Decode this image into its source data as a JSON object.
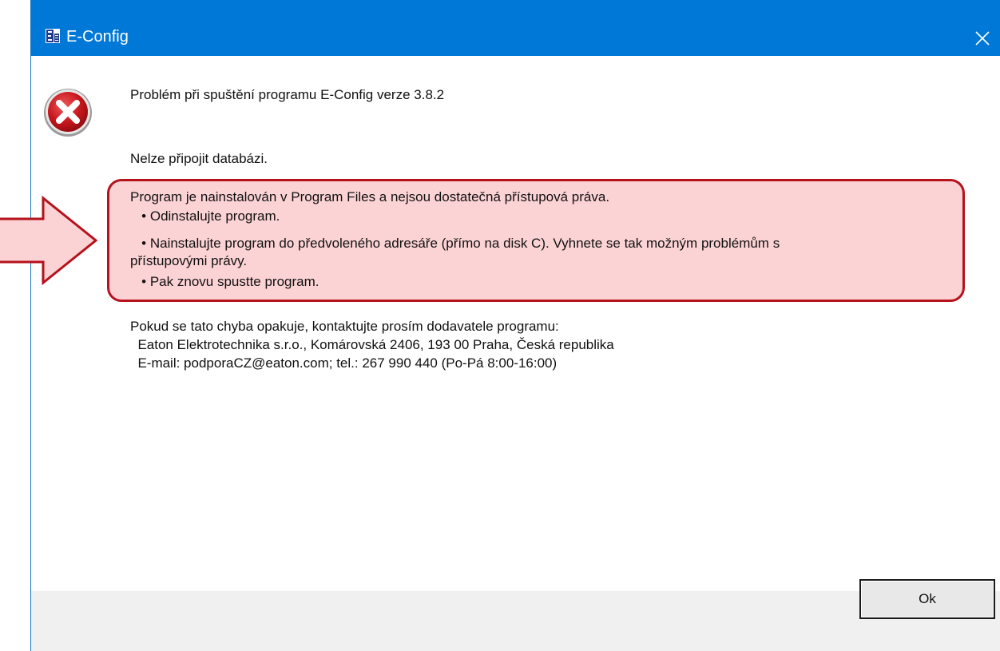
{
  "window": {
    "title": "E-Config",
    "icons": {
      "app": "e-config-app-icon",
      "close": "close-icon",
      "error": "error-x-icon"
    }
  },
  "message": {
    "heading": "Problém při spuštění programu E-Config verze 3.8.2",
    "db_error": "Nelze připojit databázi.",
    "highlight_lines": [
      "Program je nainstalován v Program Files a nejsou dostatečná přístupová práva.",
      "   • Odinstalujte program.",
      "   • Nainstalujte program do předvoleného adresáře (přímo na disk C). Vyhnete se tak možným problémům s",
      "přístupovými právy.",
      "   • Pak znovu spustte program."
    ],
    "contact_lines": [
      "Pokud se tato chyba opakuje, kontaktujte prosím dodavatele programu:",
      "  Eaton Elektrotechnika s.r.o., Komárovská 2406, 193 00 Praha, Česká republika",
      "  E-mail: podporaCZ@eaton.com; tel.: 267 990 440 (Po-Pá 8:00-16:00)"
    ]
  },
  "buttons": {
    "ok_label": "Ok"
  },
  "colors": {
    "titlebar": "#0078d7",
    "highlight_fill": "#fcd3d5",
    "highlight_border": "#b5121b",
    "arrow_fill": "#fcd3d5",
    "arrow_stroke": "#b5121b"
  }
}
